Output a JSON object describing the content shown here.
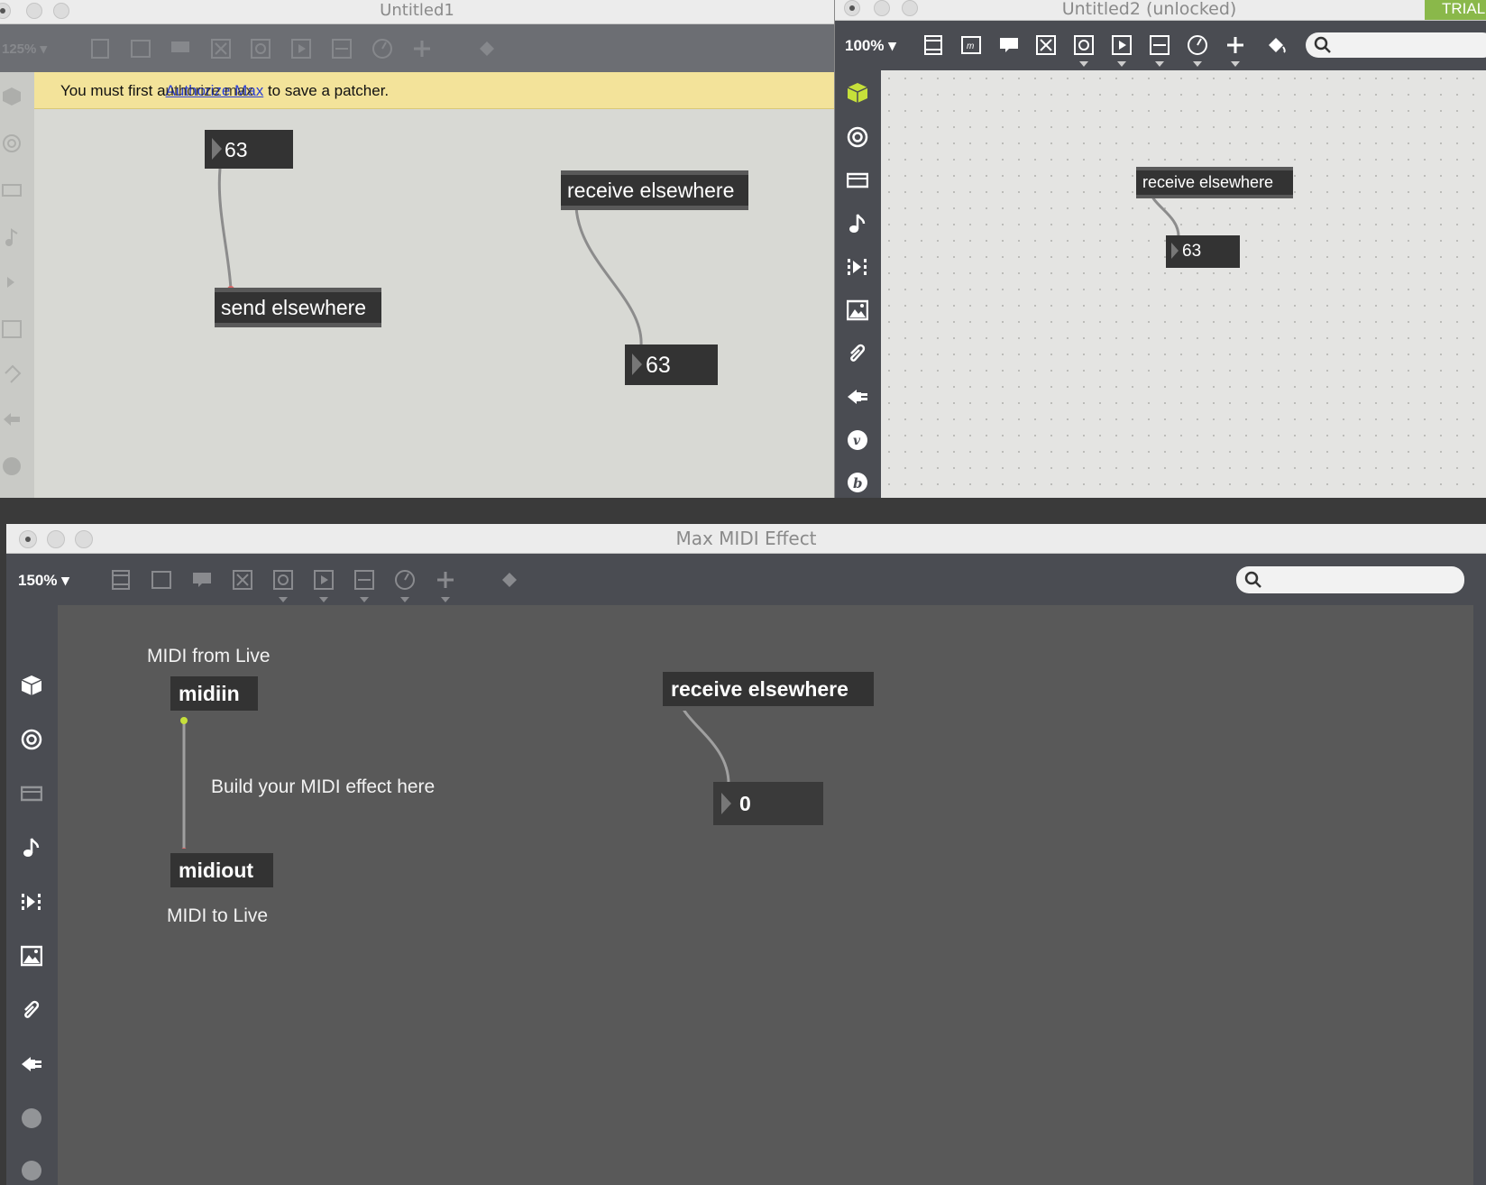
{
  "window1": {
    "title": "Untitled1",
    "zoom": "125%",
    "banner": {
      "prefix": "You must first a",
      "link": "Authorize Max",
      "overlay": "uthorize max",
      "suffix": " to save a patcher."
    },
    "objects": {
      "number_top": "63",
      "send": "send elsewhere",
      "receive": "receive elsewhere",
      "number_bottom": "63"
    }
  },
  "window2": {
    "title": "Untitled2 (unlocked)",
    "zoom": "100%",
    "trial_badge": "TRIAL",
    "objects": {
      "receive": "receive elsewhere",
      "number": "63"
    }
  },
  "window3": {
    "title": "Max MIDI Effect",
    "zoom": "150%",
    "search_placeholder": "",
    "comments": {
      "midi_from_live": "MIDI from Live",
      "build_here": "Build your MIDI effect here",
      "midi_to_live": "MIDI to Live"
    },
    "objects": {
      "midiin": "midiin",
      "midiout": "midiout",
      "receive": "receive elsewhere",
      "number": "0"
    }
  },
  "toolbar_icons": [
    "presentation-icon",
    "message-icon",
    "comment-icon",
    "toggle-icon",
    "button-icon",
    "play-icon",
    "slider-icon",
    "dial-icon",
    "plus-icon",
    "paint-bucket-icon"
  ],
  "sidebar_icons": [
    "cube-icon",
    "target-icon",
    "keyboard-icon",
    "music-note-icon",
    "sequence-icon",
    "image-icon",
    "paperclip-icon",
    "plug-icon",
    "v-icon",
    "b-icon"
  ],
  "colors": {
    "locked_canvas": "#d8d9d4",
    "unlocked_canvas": "#e4e4e2",
    "midi_canvas": "#595959",
    "toolbar_dark": "#4a4c52",
    "banner": "#f3e39a",
    "trial": "#8ab84a",
    "object_dark": "#333333",
    "cable": "#909090",
    "highlight_green": "#c6e03a"
  }
}
